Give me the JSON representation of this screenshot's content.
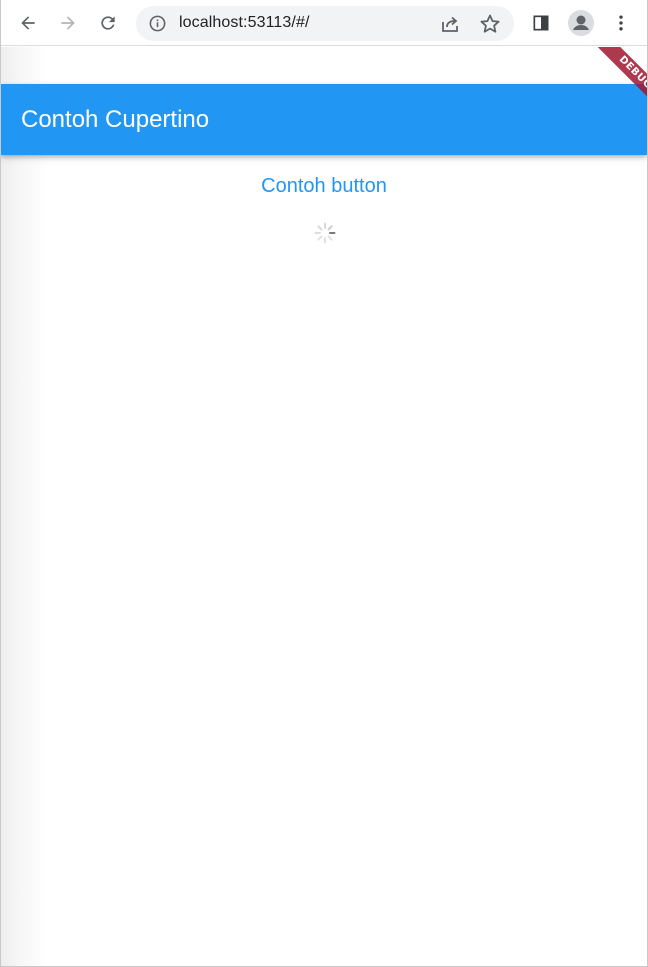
{
  "browser": {
    "url": "localhost:53113/#/",
    "icons": {
      "back": "back-arrow-icon",
      "forward": "forward-arrow-icon",
      "reload": "reload-icon",
      "info": "info-icon",
      "share": "share-icon",
      "bookmark": "star-icon",
      "sidepanel": "side-panel-icon",
      "profile": "profile-avatar-icon",
      "menu": "kebab-menu-icon"
    }
  },
  "app": {
    "title": "Contoh Cupertino",
    "button_label": "Contoh button",
    "debug_banner": "DEBUG",
    "colors": {
      "primary": "#2196f3",
      "banner": "#a0162f"
    }
  }
}
